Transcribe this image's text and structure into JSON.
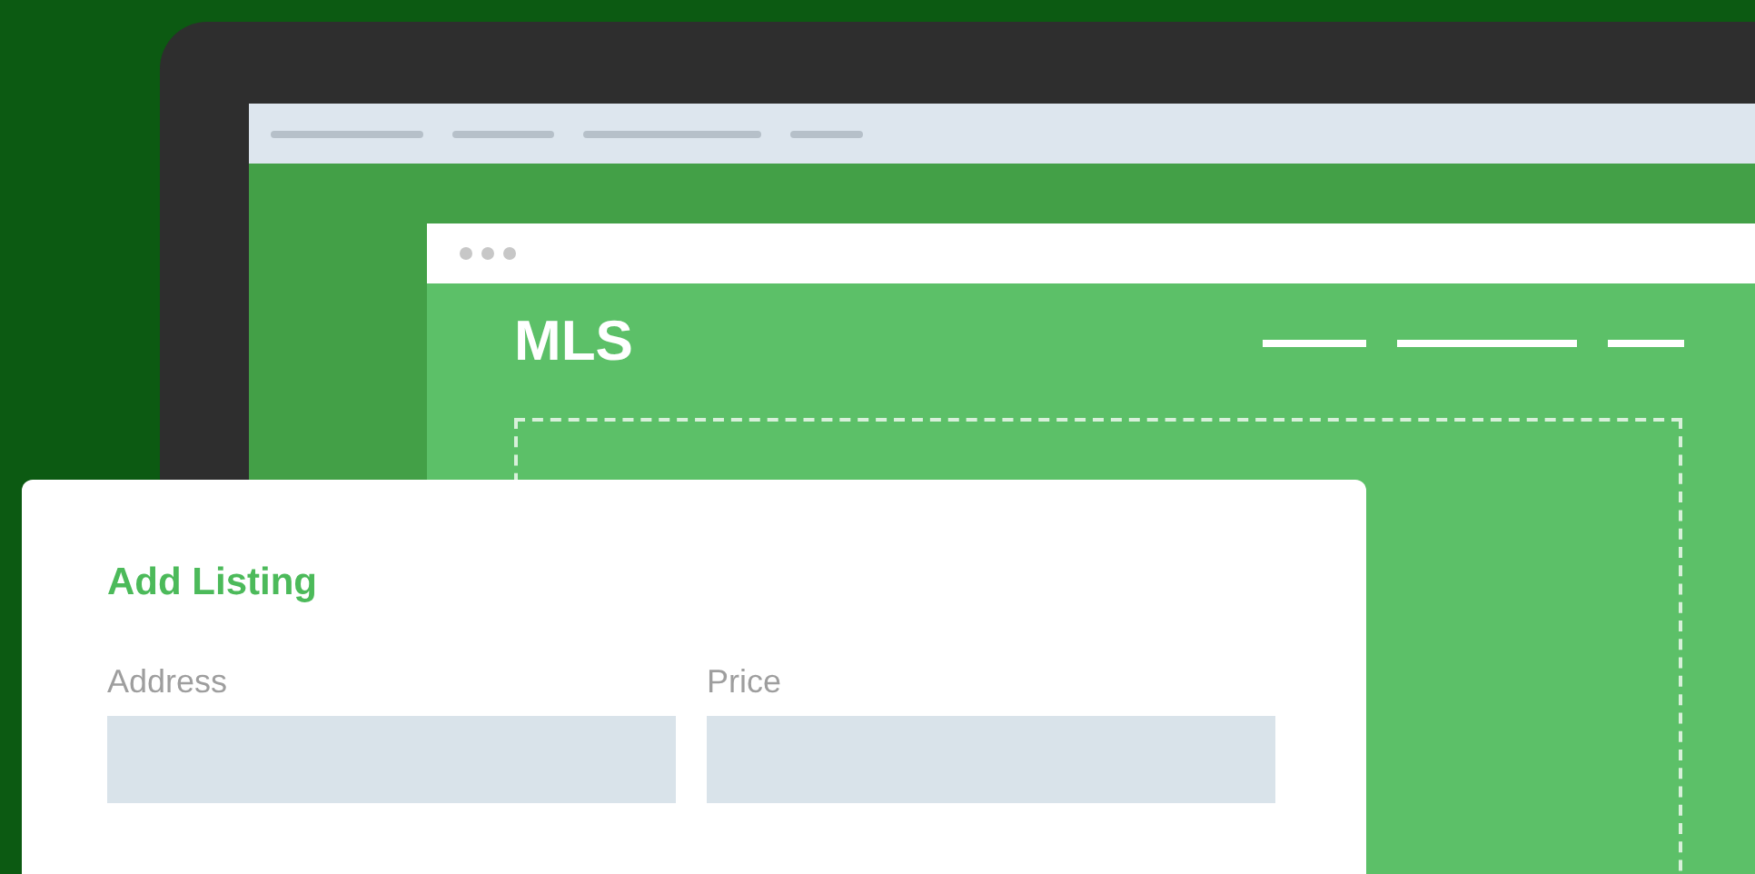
{
  "brand": "MLS",
  "form": {
    "title": "Add Listing",
    "fields": [
      {
        "label": "Address"
      },
      {
        "label": "Price"
      }
    ]
  }
}
